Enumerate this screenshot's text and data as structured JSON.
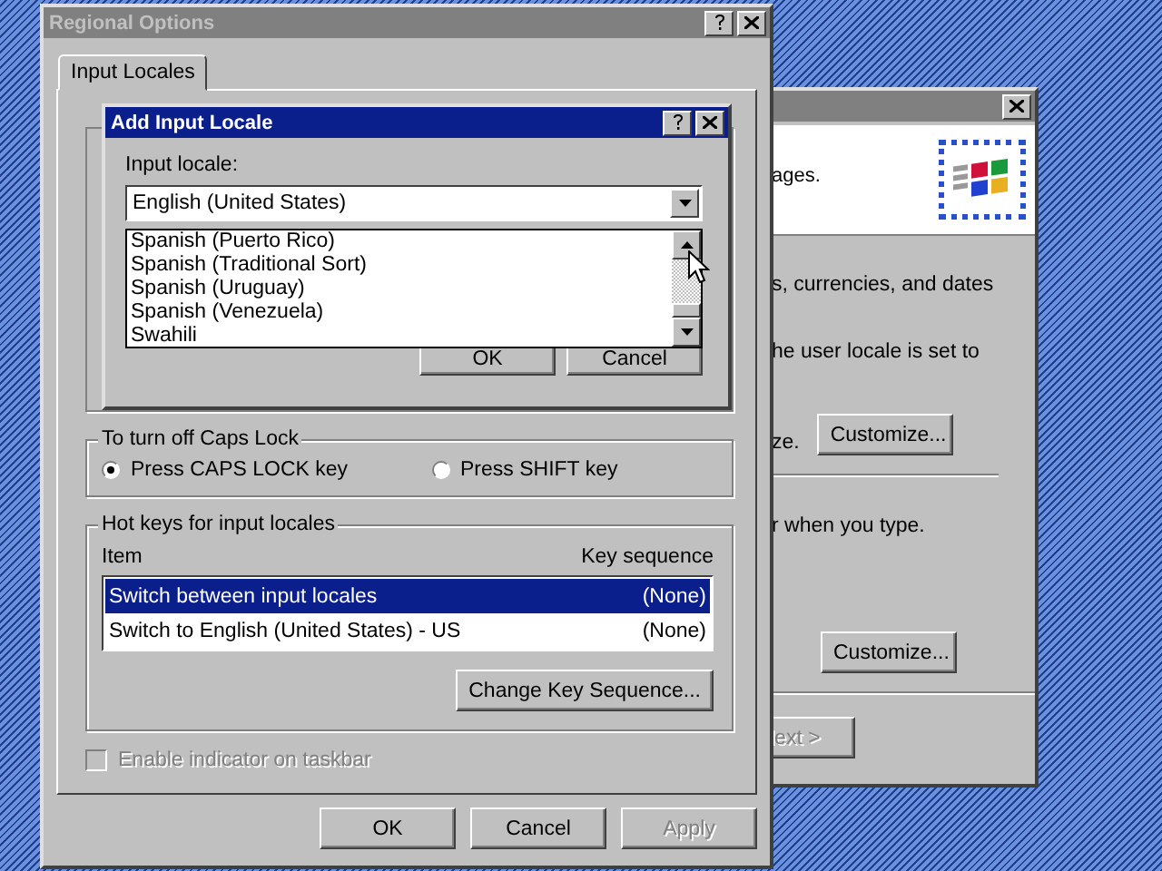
{
  "back_window": {
    "header_text": "ages.",
    "lines": [
      {
        "kind": "text",
        "text": "s, currencies, and dates"
      },
      {
        "kind": "text",
        "text": "he user locale is set to"
      },
      {
        "kind": "text_button",
        "text": "ze.",
        "button": "Customize..."
      },
      {
        "kind": "separator"
      },
      {
        "kind": "text",
        "text": "r when you type."
      },
      {
        "kind": "button",
        "button": "Customize..."
      },
      {
        "kind": "separator"
      }
    ],
    "footer_button": {
      "label": "lext >",
      "disabled": true
    }
  },
  "main_window": {
    "title": "Regional Options",
    "active": false,
    "tabs": [
      {
        "label": "Input Locales",
        "selected": true
      }
    ],
    "caps_lock": {
      "title": "To turn off Caps Lock",
      "options": [
        {
          "label": "Press CAPS LOCK key",
          "selected": true
        },
        {
          "label": "Press SHIFT key",
          "selected": false
        }
      ]
    },
    "hot_keys": {
      "title": "Hot keys for input locales",
      "columns": [
        "Item",
        "Key sequence"
      ],
      "rows": [
        {
          "item": "Switch between input locales",
          "key": "(None)",
          "selected": true
        },
        {
          "item": "Switch to English (United States) - US",
          "key": "(None)",
          "selected": false
        }
      ],
      "button": "Change Key Sequence..."
    },
    "indicator": {
      "label": "Enable indicator on taskbar",
      "checked": false,
      "disabled": true
    },
    "buttons": [
      {
        "label": "OK",
        "disabled": false
      },
      {
        "label": "Cancel",
        "disabled": false
      },
      {
        "label": "Apply",
        "disabled": true
      }
    ]
  },
  "dialog": {
    "title": "Add Input Locale",
    "active": true,
    "field_label": "Input locale:",
    "value": "English (United States)",
    "list": [
      "Spanish (Puerto Rico)",
      "Spanish (Traditional Sort)",
      "Spanish (Uruguay)",
      "Spanish (Venezuela)",
      "Swahili"
    ],
    "buttons": [
      "OK",
      "Cancel"
    ]
  }
}
